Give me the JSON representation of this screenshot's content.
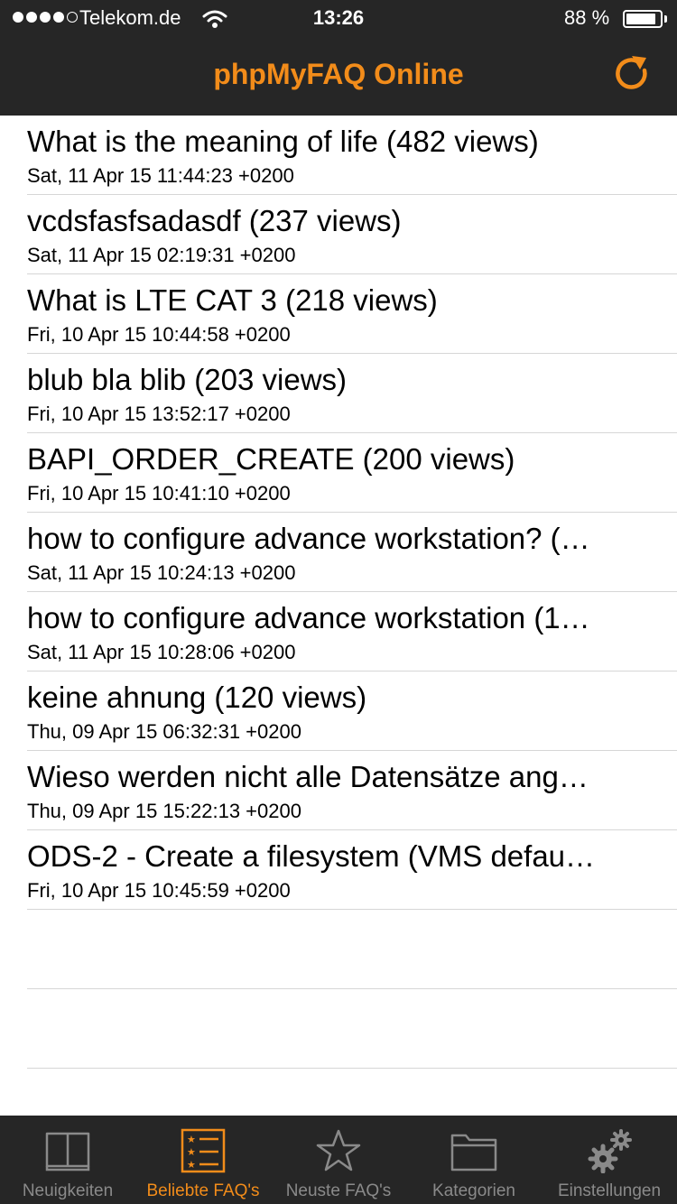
{
  "status_bar": {
    "carrier": "Telekom.de",
    "time": "13:26",
    "battery": "88 %",
    "battery_level": 0.88,
    "signal_bars": 4,
    "signal_max": 5
  },
  "nav": {
    "title": "phpMyFAQ Online",
    "refresh_icon": "refresh-icon"
  },
  "colors": {
    "accent": "#f28c1a",
    "bar_background": "#262626",
    "inactive": "#8a8a8a"
  },
  "faqs": [
    {
      "title": "What is the meaning of life (482 views)",
      "date": "Sat, 11 Apr 15 11:44:23 +0200"
    },
    {
      "title": "vcdsfasfsadasdf (237 views)",
      "date": "Sat, 11 Apr 15 02:19:31 +0200"
    },
    {
      "title": "What is LTE CAT 3 (218 views)",
      "date": "Fri, 10 Apr 15 10:44:58 +0200"
    },
    {
      "title": "blub bla blib (203 views)",
      "date": "Fri, 10 Apr 15 13:52:17 +0200"
    },
    {
      "title": "BAPI_ORDER_CREATE (200 views)",
      "date": "Fri, 10 Apr 15 10:41:10 +0200"
    },
    {
      "title": "how to configure advance workstation? (…",
      "date": "Sat, 11 Apr 15 10:24:13 +0200"
    },
    {
      "title": "how to configure advance workstation (1…",
      "date": "Sat, 11 Apr 15 10:28:06 +0200"
    },
    {
      "title": "keine ahnung (120 views)",
      "date": "Thu, 09 Apr 15 06:32:31 +0200"
    },
    {
      "title": "Wieso werden nicht alle Datensätze ang…",
      "date": "Thu, 09 Apr 15 15:22:13 +0200"
    },
    {
      "title": "ODS-2 - Create a filesystem (VMS defau…",
      "date": "Fri, 10 Apr 15 10:45:59 +0200"
    }
  ],
  "tabs": [
    {
      "label": "Neuigkeiten",
      "icon": "book-icon",
      "active": false
    },
    {
      "label": "Beliebte FAQ's",
      "icon": "list-icon",
      "active": true
    },
    {
      "label": "Neuste FAQ's",
      "icon": "star-icon",
      "active": false
    },
    {
      "label": "Kategorien",
      "icon": "folder-icon",
      "active": false
    },
    {
      "label": "Einstellungen",
      "icon": "gears-icon",
      "active": false
    }
  ]
}
